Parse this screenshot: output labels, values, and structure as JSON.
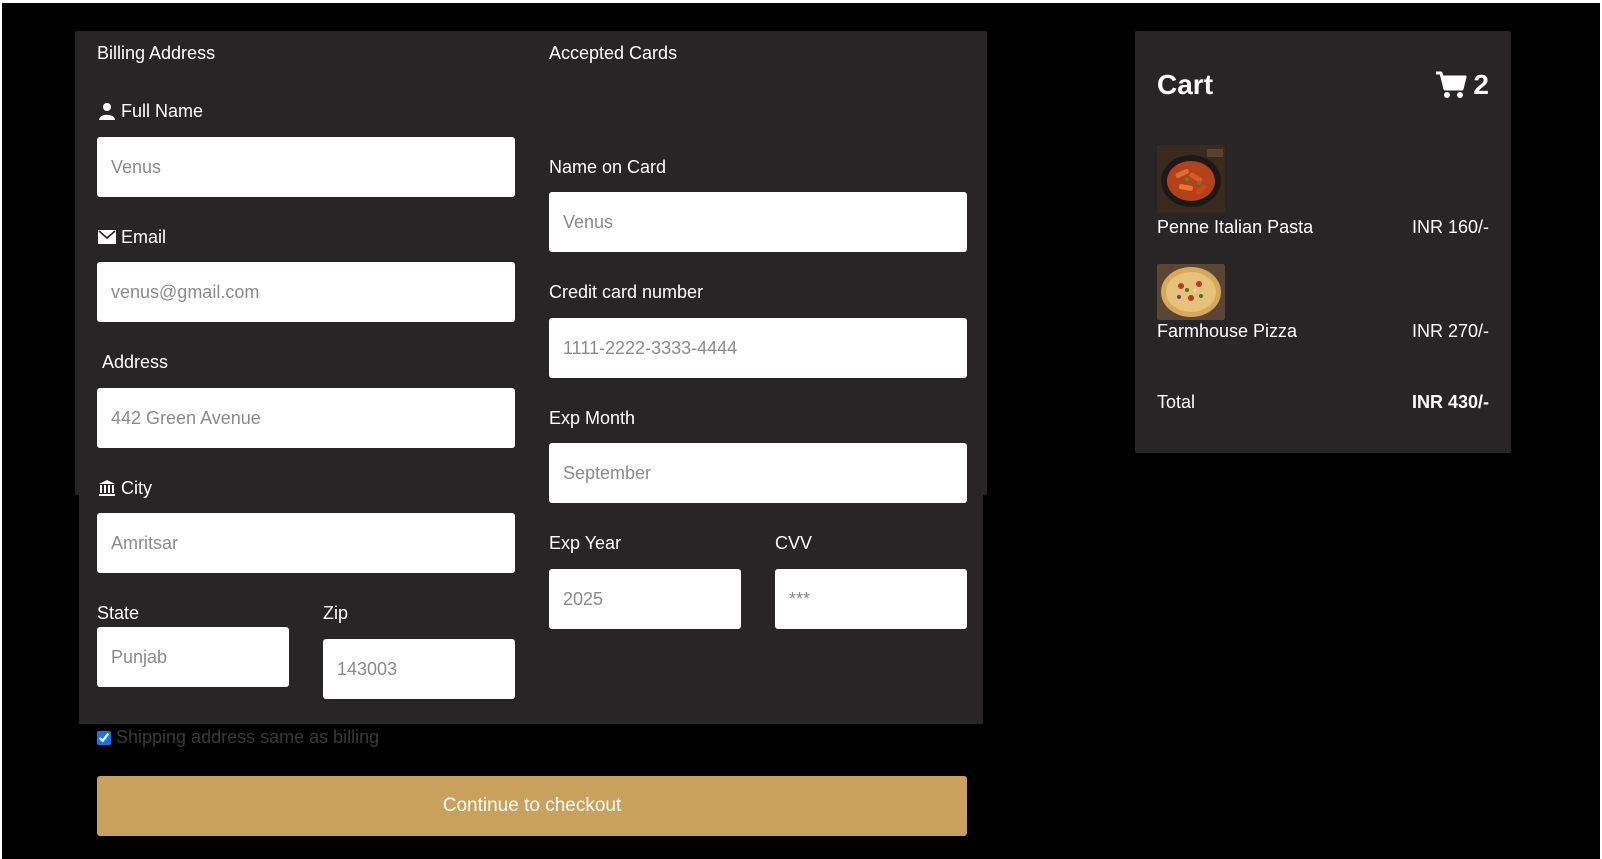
{
  "billing": {
    "title": "Billing Address",
    "full_name_label": "Full Name",
    "full_name_placeholder": "Venus",
    "email_label": "Email",
    "email_placeholder": "venus@gmail.com",
    "address_label": "Address",
    "address_placeholder": "442 Green Avenue",
    "city_label": "City",
    "city_placeholder": "Amritsar",
    "state_label": "State",
    "state_placeholder": "Punjab",
    "zip_label": "Zip",
    "zip_placeholder": "143003"
  },
  "payment": {
    "title": "Accepted Cards",
    "name_on_card_label": "Name on Card",
    "name_on_card_placeholder": "Venus",
    "card_number_label": "Credit card number",
    "card_number_placeholder": "1111-2222-3333-4444",
    "exp_month_label": "Exp Month",
    "exp_month_placeholder": "September",
    "exp_year_label": "Exp Year",
    "exp_year_placeholder": "2025",
    "cvv_label": "CVV",
    "cvv_placeholder": "***"
  },
  "shipping_same_label": "Shipping address same as billing",
  "shipping_same_checked": true,
  "checkout_button_label": "Continue to checkout",
  "cart": {
    "title": "Cart",
    "count": "2",
    "items": [
      {
        "name": "Penne Italian Pasta",
        "price": "INR 160/-",
        "image": "pasta-dish"
      },
      {
        "name": "Farmhouse Pizza",
        "price": "INR 270/-",
        "image": "pizza"
      }
    ],
    "total_label": "Total",
    "total_value": "INR 430/-"
  },
  "colors": {
    "background": "#000000",
    "panel": "#272525",
    "button": "#c9a15c",
    "input": "#ffffff"
  },
  "icons": {
    "full_name": "user-icon",
    "email": "envelope-icon",
    "city": "institution-icon",
    "cart": "shopping-cart-icon"
  }
}
